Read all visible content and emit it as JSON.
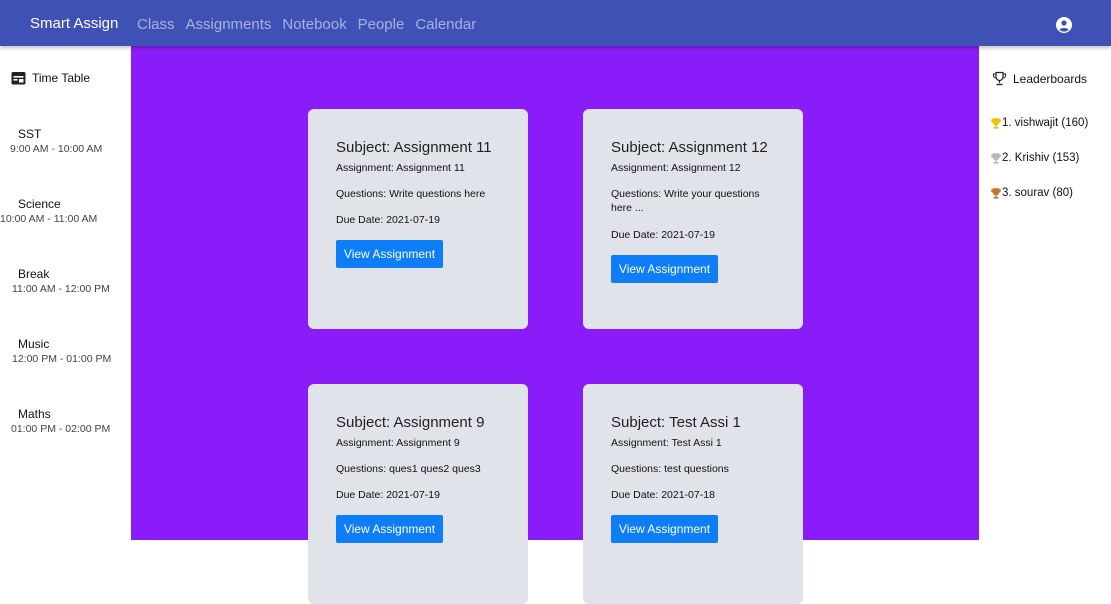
{
  "topbar": {
    "brand": "Smart Assign",
    "nav": [
      "Class",
      "Assignments",
      "Notebook",
      "People",
      "Calendar"
    ],
    "account_icon": "account-circle-icon"
  },
  "timetable": {
    "title": "Time Table",
    "icon": "calendar-icon",
    "slots": [
      {
        "subject": "SST",
        "time": "9:00 AM - 10:00 AM"
      },
      {
        "subject": "Science",
        "time": "10:00 AM - 11:00 AM"
      },
      {
        "subject": "Break",
        "time": "11:00 AM - 12:00 PM"
      },
      {
        "subject": "Music",
        "time": "12:00 PM - 01:00 PM"
      },
      {
        "subject": "Maths",
        "time": "01:00 PM - 02:00 PM"
      }
    ]
  },
  "cards": [
    {
      "title": "Subject: Assignment 11",
      "assignment": "Assignment: Assignment 11",
      "questions": "Questions: Write questions here",
      "due": "Due Date: 2021-07-19",
      "button": "View Assignment"
    },
    {
      "title": "Subject: Assignment 12",
      "assignment": "Assignment: Assignment 12",
      "questions": "Questions: Write your questions here ...",
      "due": "Due Date: 2021-07-19",
      "button": "View Assignment"
    },
    {
      "title": "Subject: Assignment 9",
      "assignment": "Assignment: Assignment 9",
      "questions": "Questions: ques1 ques2 ques3",
      "due": "Due Date: 2021-07-19",
      "button": "View Assignment"
    },
    {
      "title": "Subject: Test Assi 1",
      "assignment": "Assignment: Test Assi 1",
      "questions": "Questions: test questions",
      "due": "Due Date: 2021-07-18",
      "button": "View Assignment"
    }
  ],
  "leaderboard": {
    "title": "Leaderboards",
    "icon": "trophy-outline-icon",
    "entries": [
      {
        "text": "1. vishwajit (160)",
        "icon": "gold-trophy-icon",
        "color": "#f2c200"
      },
      {
        "text": "2. Krishiv (153)",
        "icon": "silver-trophy-icon",
        "color": "#b8b8b8"
      },
      {
        "text": "3. sourav (80)",
        "icon": "bronze-trophy-icon",
        "color": "#c87533"
      }
    ]
  },
  "colors": {
    "topbar": "#3f51b5",
    "main_bg": "#8a1cf9",
    "card_bg": "#e1e3eb",
    "button": "#0d7ef7"
  }
}
